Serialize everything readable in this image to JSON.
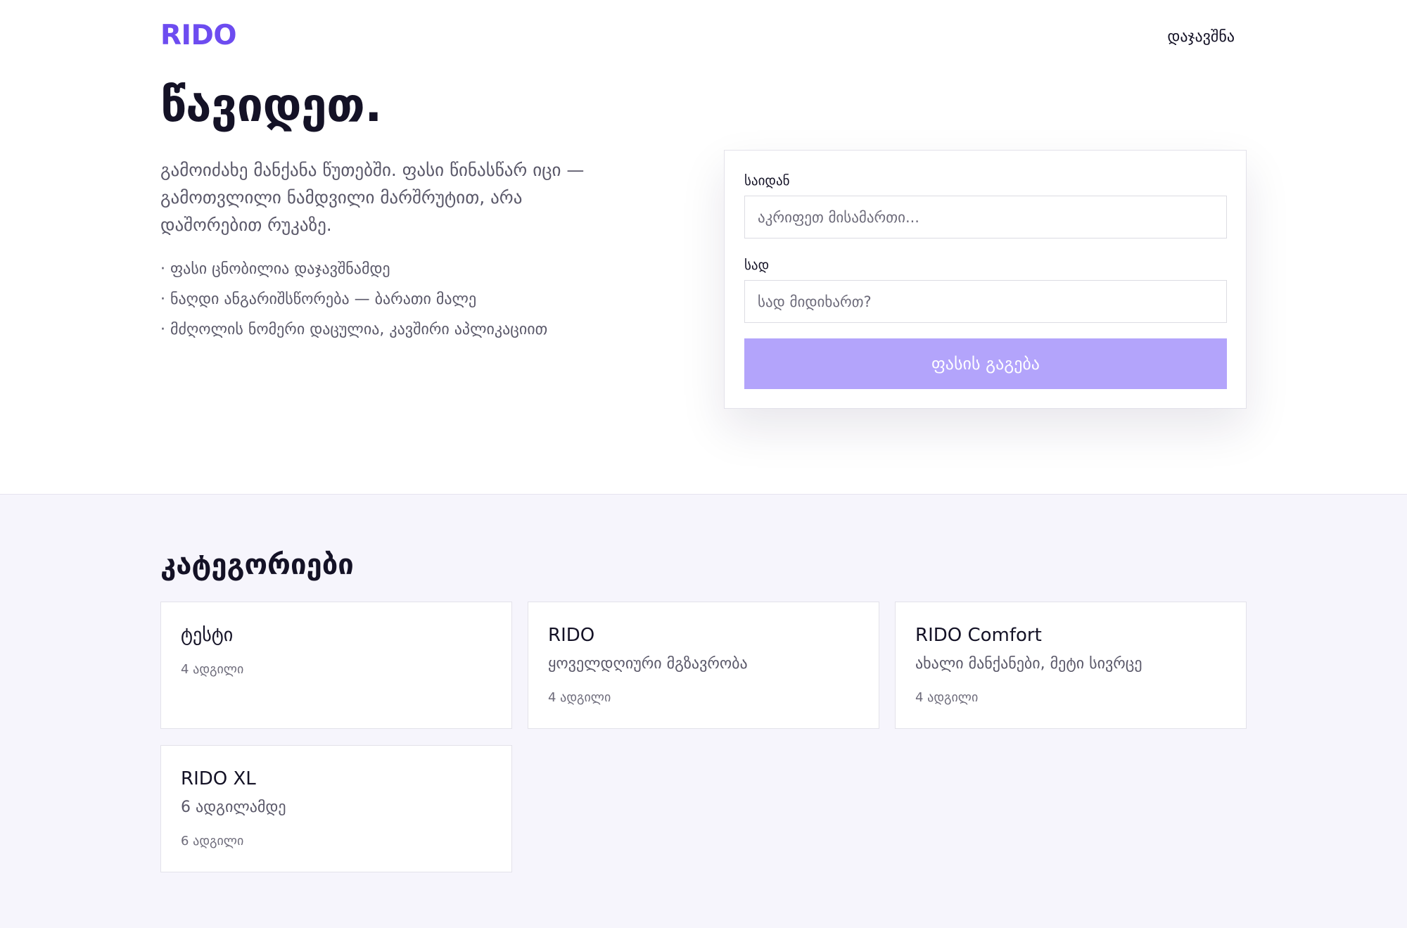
{
  "header": {
    "logo": "RIDO",
    "login_label": "დაჯავშნა"
  },
  "hero": {
    "title": "წავიდეთ.",
    "subtitle": "გამოიძახე მანქანა წუთებში. ფასი წინასწარ იცი — გამოთვლილი ნამდვილი მარშრუტით, არა დაშორებით რუკაზე.",
    "features": [
      "· ფასი ცნობილია დაჯავშნამდე",
      "· ნაღდი ანგარიშსწორება — ბარათი მალე",
      "· მძღოლის ნომერი დაცულია, კავშირი აპლიკაციით"
    ]
  },
  "booking": {
    "from_label": "საიდან",
    "from_placeholder": "აკრიფეთ მისამართი...",
    "from_value": "",
    "to_label": "სად",
    "to_placeholder": "სად მიდიხართ?",
    "to_value": "",
    "submit_label": "ფასის გაგება"
  },
  "categories": {
    "title": "კატეგორიები",
    "items": [
      {
        "name": "ტესტი",
        "description": "",
        "seats": "4 ადგილი"
      },
      {
        "name": "RIDO",
        "description": "ყოველდღიური მგზავრობა",
        "seats": "4 ადგილი"
      },
      {
        "name": "RIDO Comfort",
        "description": "ახალი მანქანები, მეტი სივრცე",
        "seats": "4 ადგილი"
      },
      {
        "name": "RIDO XL",
        "description": "6 ადგილამდე",
        "seats": "6 ადგილი"
      }
    ]
  },
  "colors": {
    "brand": "#6d4cf0",
    "button": "#b3a4fb",
    "section_bg": "#f6f5fc",
    "text": "#141226",
    "muted": "#5a5869"
  }
}
